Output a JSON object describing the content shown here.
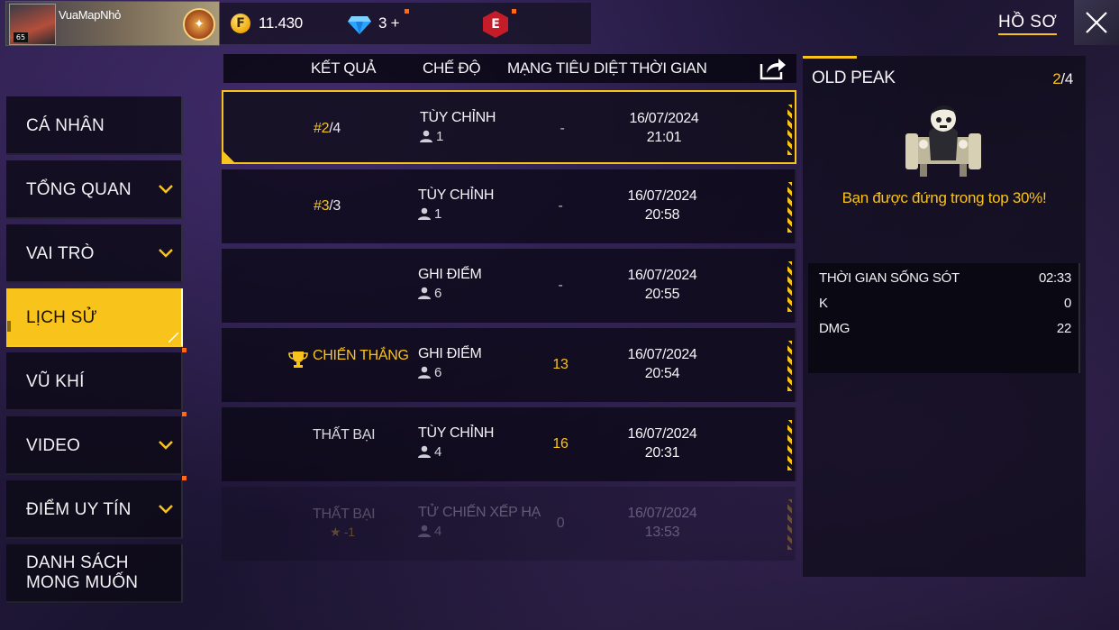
{
  "header": {
    "player_name": "VuaMapNhỏ",
    "player_level": "65",
    "coins": "11.430",
    "diamonds": "3",
    "diamonds_add": "+",
    "elite_badge": "E",
    "page_title": "HỒ SƠ"
  },
  "sidebar": {
    "items": [
      {
        "label": "CÁ NHÂN",
        "has_chevron": false,
        "active": false,
        "badge": false
      },
      {
        "label": "TỔNG QUAN",
        "has_chevron": true,
        "active": false,
        "badge": false
      },
      {
        "label": "VAI TRÒ",
        "has_chevron": true,
        "active": false,
        "badge": false
      },
      {
        "label": "LỊCH SỬ",
        "has_chevron": false,
        "active": true,
        "badge": false
      },
      {
        "label": "VŨ KHÍ",
        "has_chevron": false,
        "active": false,
        "badge": true
      },
      {
        "label": "VIDEO",
        "has_chevron": true,
        "active": false,
        "badge": true
      },
      {
        "label": "ĐIỂM UY TÍN",
        "has_chevron": true,
        "active": false,
        "badge": true
      },
      {
        "label_line1": "DANH SÁCH",
        "label_line2": "MONG MUỐN",
        "has_chevron": false,
        "active": false,
        "badge": false
      }
    ]
  },
  "history": {
    "columns": {
      "result": "KẾT QUẢ",
      "mode": "CHẾ ĐỘ",
      "kills": "MẠNG TIÊU DIỆT",
      "time": "THỜI GIAN"
    },
    "rows": [
      {
        "result_rank": "#2",
        "result_total": "/4",
        "mode": "TÙY CHỈNH",
        "players": "1",
        "kills": "-",
        "date": "16/07/2024",
        "time": "21:01"
      },
      {
        "result_rank": "#3",
        "result_total": "/3",
        "mode": "TÙY CHỈNH",
        "players": "1",
        "kills": "-",
        "date": "16/07/2024",
        "time": "20:58"
      },
      {
        "result_rank": "",
        "result_total": "",
        "mode": "GHI ĐIỂM",
        "players": "6",
        "kills": "-",
        "date": "16/07/2024",
        "time": "20:55"
      },
      {
        "result_text": "CHIẾN THẮNG",
        "mode": "GHI ĐIỂM",
        "players": "6",
        "kills": "13",
        "date": "16/07/2024",
        "time": "20:54"
      },
      {
        "result_text": "THẤT BẠI",
        "mode": "TÙY CHỈNH",
        "players": "4",
        "kills": "16",
        "date": "16/07/2024",
        "time": "20:31"
      },
      {
        "result_text": "THẤT BẠI",
        "result_sub": "-1",
        "mode": "TỬ CHIẾN XẾP HẠ",
        "players": "4",
        "kills": "0",
        "date": "16/07/2024",
        "time": "13:53"
      }
    ]
  },
  "detail": {
    "map_name": "OLD PEAK",
    "placement_rank": "2",
    "placement_total": "/4",
    "message": "Bạn được đứng trong top 30%!",
    "stats": [
      {
        "label": "THỜI GIAN SỐNG SÓT",
        "value": "02:33"
      },
      {
        "label": "K",
        "value": "0"
      },
      {
        "label": "DMG",
        "value": "22"
      }
    ]
  },
  "colors": {
    "accent": "#f8c31a",
    "notification": "#ff6a1a",
    "panel": "#0e0c18"
  }
}
